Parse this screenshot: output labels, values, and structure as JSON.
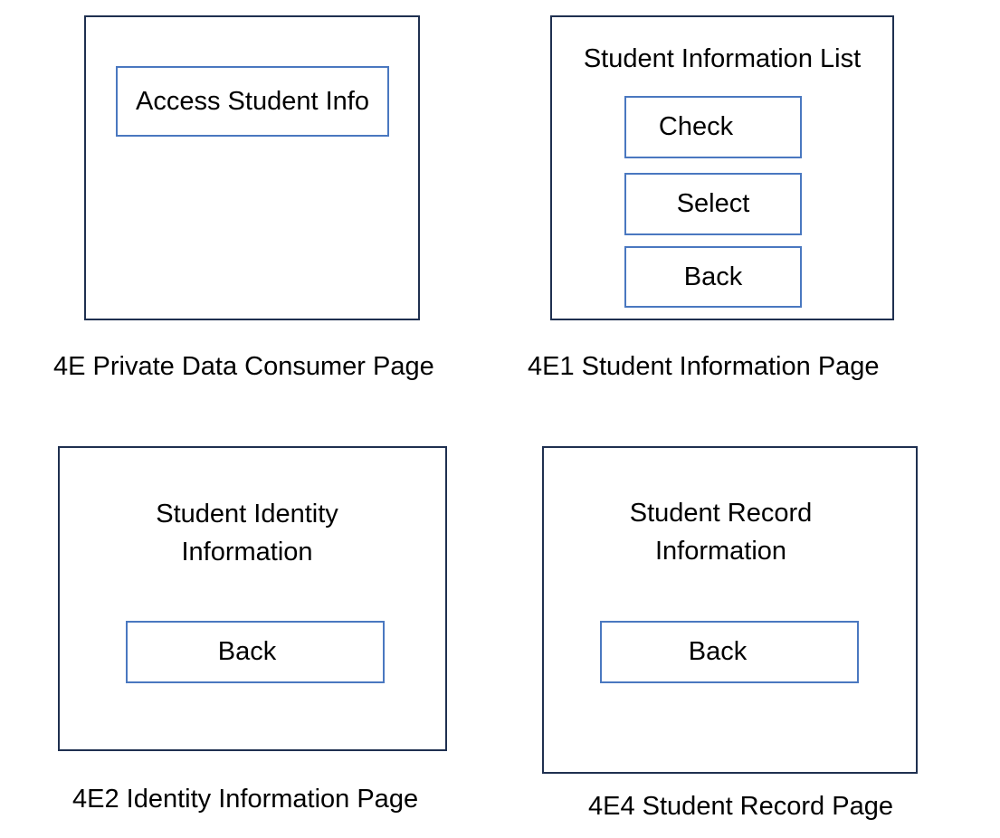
{
  "panels": {
    "private_data_consumer": {
      "button_label": "Access Student Info",
      "caption": "4E Private Data Consumer Page"
    },
    "student_information": {
      "title": "Student Information List",
      "buttons": [
        "Check",
        "Select",
        "Back"
      ],
      "caption": "4E1 Student Information Page"
    },
    "identity_information": {
      "title_lines": [
        "Student Identity",
        "Information"
      ],
      "button_label": "Back",
      "caption": "4E2 Identity Information Page"
    },
    "student_record": {
      "title_lines": [
        "Student Record",
        "Information"
      ],
      "button_label": "Back",
      "caption": "4E4 Student Record Page"
    }
  },
  "colors": {
    "frame_border": "#1f3050",
    "button_border": "#4a78c0",
    "text": "#000000",
    "background": "#ffffff"
  }
}
